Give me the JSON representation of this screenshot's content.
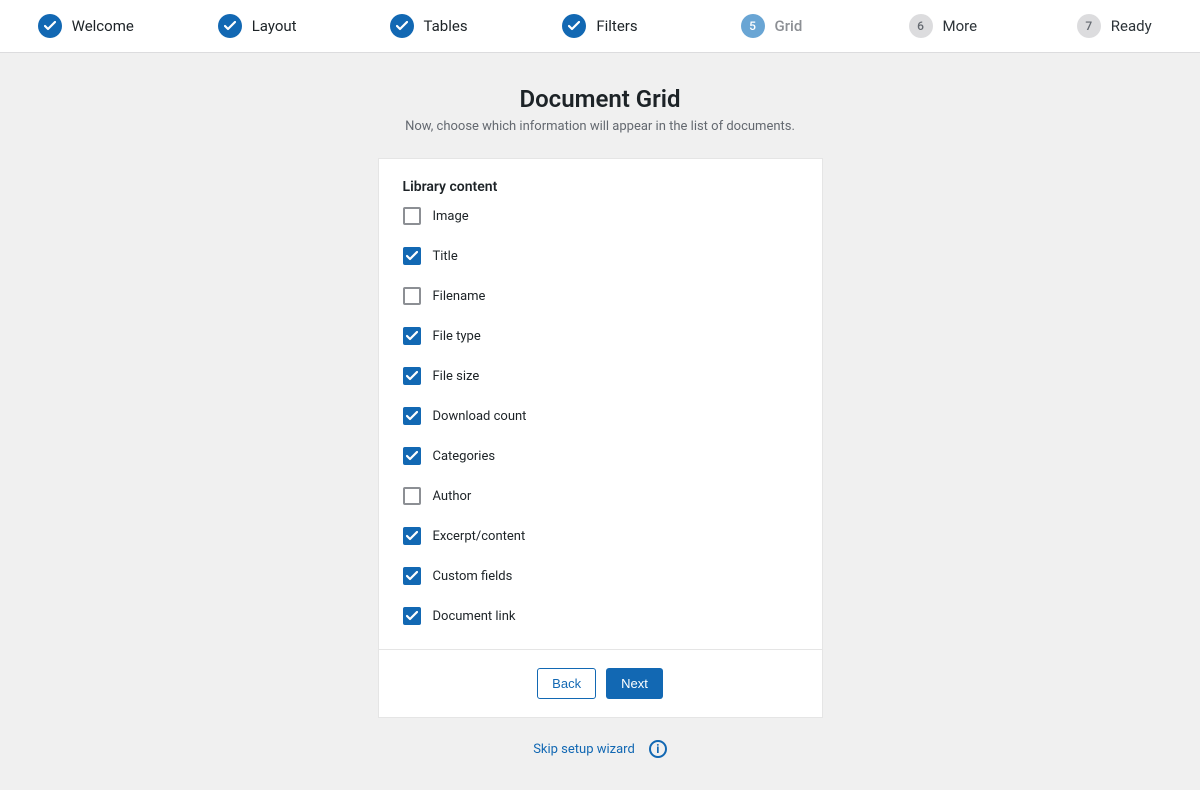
{
  "stepper": {
    "steps": [
      {
        "label": "Welcome",
        "state": "completed"
      },
      {
        "label": "Layout",
        "state": "completed"
      },
      {
        "label": "Tables",
        "state": "completed"
      },
      {
        "label": "Filters",
        "state": "completed"
      },
      {
        "label": "Grid",
        "state": "active",
        "number": "5"
      },
      {
        "label": "More",
        "state": "pending",
        "number": "6"
      },
      {
        "label": "Ready",
        "state": "pending",
        "number": "7"
      }
    ]
  },
  "header": {
    "title": "Document Grid",
    "subtitle": "Now, choose which information will appear in the list of documents."
  },
  "section": {
    "label": "Library content",
    "options": [
      {
        "label": "Image",
        "checked": false
      },
      {
        "label": "Title",
        "checked": true
      },
      {
        "label": "Filename",
        "checked": false
      },
      {
        "label": "File type",
        "checked": true
      },
      {
        "label": "File size",
        "checked": true
      },
      {
        "label": "Download count",
        "checked": true
      },
      {
        "label": "Categories",
        "checked": true
      },
      {
        "label": "Author",
        "checked": false
      },
      {
        "label": "Excerpt/content",
        "checked": true
      },
      {
        "label": "Custom fields",
        "checked": true
      },
      {
        "label": "Document link",
        "checked": true
      }
    ]
  },
  "footer": {
    "back": "Back",
    "next": "Next",
    "skip": "Skip setup wizard"
  },
  "icons": {
    "info": "i"
  }
}
